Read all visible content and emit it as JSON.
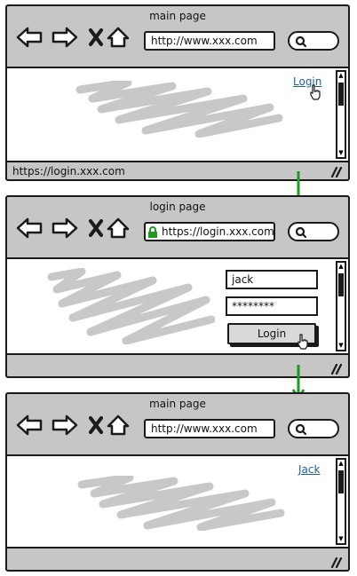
{
  "frames": [
    {
      "title": "main page",
      "url": "http://www.xxx.com",
      "link": "Login",
      "status": "https://login.xxx.com"
    },
    {
      "title": "login page",
      "url": "https://login.xxx.com",
      "username": "jack",
      "password": "********",
      "login_button": "Login"
    },
    {
      "title": "main page",
      "url": "http://www.xxx.com",
      "link": "Jack"
    }
  ],
  "colors": {
    "chrome": "#c6c6c6",
    "arrow": "#1f9a1f",
    "link": "#1f5f9a",
    "lock": "#1f9a1f",
    "scribble": "#c8c8c8"
  }
}
